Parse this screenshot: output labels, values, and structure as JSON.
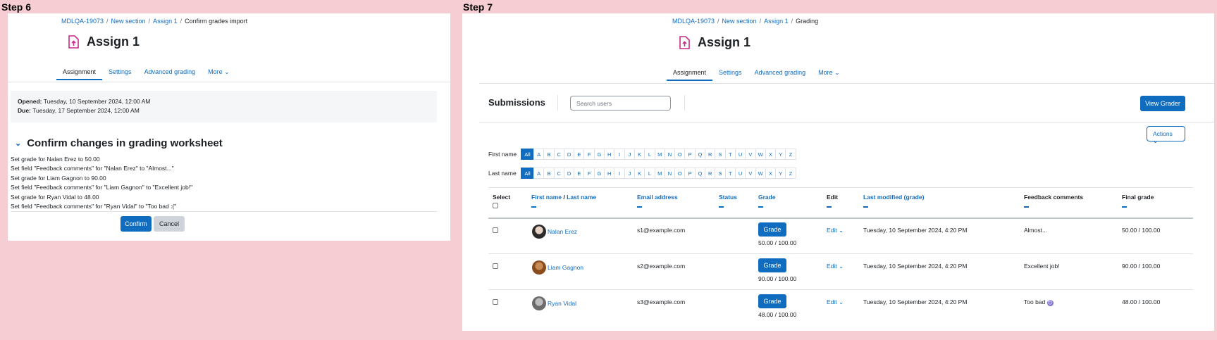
{
  "step6": {
    "label": "Step 6",
    "breadcrumb": [
      "MDLQA-19073",
      "New section",
      "Assign 1",
      "Confirm grades import"
    ],
    "title": "Assign 1",
    "tabs": [
      "Assignment",
      "Settings",
      "Advanced grading",
      "More"
    ],
    "opened_label": "Opened:",
    "opened_value": "Tuesday, 10 September 2024, 12:00 AM",
    "due_label": "Due:",
    "due_value": "Tuesday, 17 September 2024, 12:00 AM",
    "confirm_heading": "Confirm changes in grading worksheet",
    "changes": [
      "Set grade for Nalan Erez to 50.00",
      "Set field \"Feedback comments\" for \"Nalan Erez\" to \"Almost...\"",
      "Set grade for Liam Gagnon to 90.00",
      "Set field \"Feedback comments\" for \"Liam Gagnon\" to \"Excellent job!\"",
      "Set grade for Ryan Vidal to 48.00",
      "Set field \"Feedback comments\" for \"Ryan Vidal\" to \"Too bad :(\""
    ],
    "confirm_button": "Confirm",
    "cancel_button": "Cancel"
  },
  "step7": {
    "label": "Step 7",
    "breadcrumb": [
      "MDLQA-19073",
      "New section",
      "Assign 1",
      "Grading"
    ],
    "title": "Assign 1",
    "tabs": [
      "Assignment",
      "Settings",
      "Advanced grading",
      "More"
    ],
    "submissions_title": "Submissions",
    "search_placeholder": "Search users",
    "view_grader": "View Grader",
    "actions": "Actions",
    "first_name_label": "First name",
    "last_name_label": "Last name",
    "letters": [
      "All",
      "A",
      "B",
      "C",
      "D",
      "E",
      "F",
      "G",
      "H",
      "I",
      "J",
      "K",
      "L",
      "M",
      "N",
      "O",
      "P",
      "Q",
      "R",
      "S",
      "T",
      "U",
      "V",
      "W",
      "X",
      "Y",
      "Z"
    ],
    "columns": {
      "select": "Select",
      "first_name": "First name",
      "name_sep": "/",
      "last_name": "Last name",
      "email": "Email address",
      "status": "Status",
      "grade": "Grade",
      "edit": "Edit",
      "last_modified": "Last modified (grade)",
      "feedback": "Feedback comments",
      "final_grade": "Final grade"
    },
    "grade_button": "Grade",
    "edit_label": "Edit",
    "rows": [
      {
        "name": "Nalan Erez",
        "email": "s1@example.com",
        "grade": "50.00 / 100.00",
        "modified": "Tuesday, 10 September 2024, 4:20 PM",
        "feedback": "Almost...",
        "final": "50.00 / 100.00"
      },
      {
        "name": "Liam Gagnon",
        "email": "s2@example.com",
        "grade": "90.00 / 100.00",
        "modified": "Tuesday, 10 September 2024, 4:20 PM",
        "feedback": "Excellent job!",
        "final": "90.00 / 100.00"
      },
      {
        "name": "Ryan Vidal",
        "email": "s3@example.com",
        "grade": "48.00 / 100.00",
        "modified": "Tuesday, 10 September 2024, 4:20 PM",
        "feedback": "Too bad",
        "final": "48.00 / 100.00"
      }
    ]
  }
}
